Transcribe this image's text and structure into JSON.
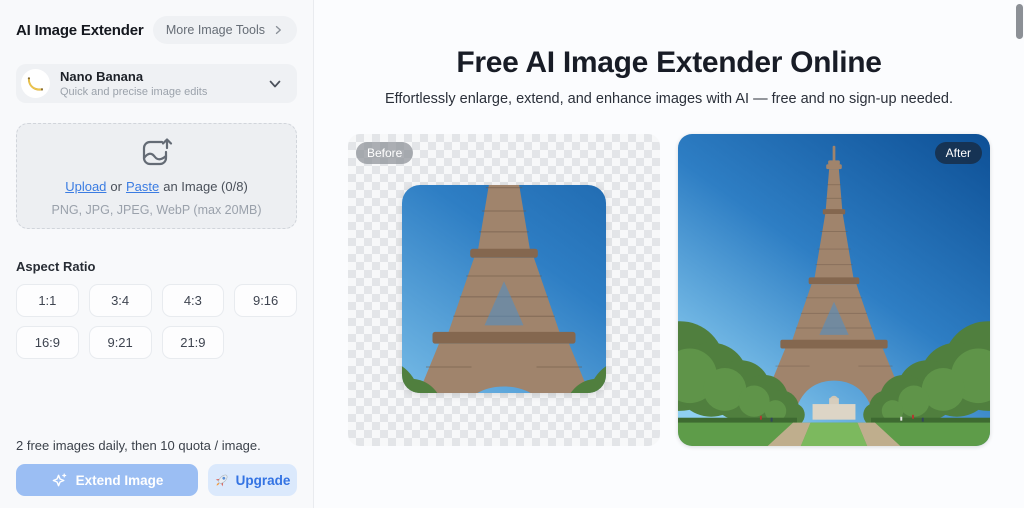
{
  "sidebar": {
    "title": "AI Image Extender",
    "more_tools_label": "More Image Tools",
    "model": {
      "name": "Nano Banana",
      "description": "Quick and precise image edits"
    },
    "upload": {
      "upload_label": "Upload",
      "or_label": "or",
      "paste_label": "Paste",
      "suffix_label": "an Image (0/8)",
      "formats": "PNG, JPG, JPEG, WebP (max 20MB)"
    },
    "aspect_ratio": {
      "label": "Aspect Ratio",
      "options": [
        "1:1",
        "3:4",
        "4:3",
        "9:16",
        "16:9",
        "9:21",
        "21:9"
      ]
    },
    "quota_note": "2 free images daily, then 10 quota / image.",
    "extend_button_label": "Extend Image",
    "upgrade_button_label": "Upgrade"
  },
  "main": {
    "title": "Free AI Image Extender Online",
    "subtitle": "Effortlessly enlarge, extend, and enhance images with AI — free and no sign-up needed.",
    "before_badge": "Before",
    "after_badge": "After"
  },
  "icons": {
    "model": "banana-icon",
    "model_expander": "chevron-down-icon",
    "more_tools": "chevron-right-icon",
    "upload": "image-upload-icon",
    "extend": "sparkle-icon",
    "upgrade": "rocket-icon"
  },
  "colors": {
    "link_blue": "#3b7ce2",
    "extend_button": "#9bbef3",
    "upgrade_bg": "#dbe9fc",
    "upgrade_text": "#3373e3",
    "sidebar_bg": "#f8f9fb",
    "main_bg": "#fbfcfe",
    "after_badge_bg": "#182a42",
    "before_badge_bg": "#8e9297"
  }
}
